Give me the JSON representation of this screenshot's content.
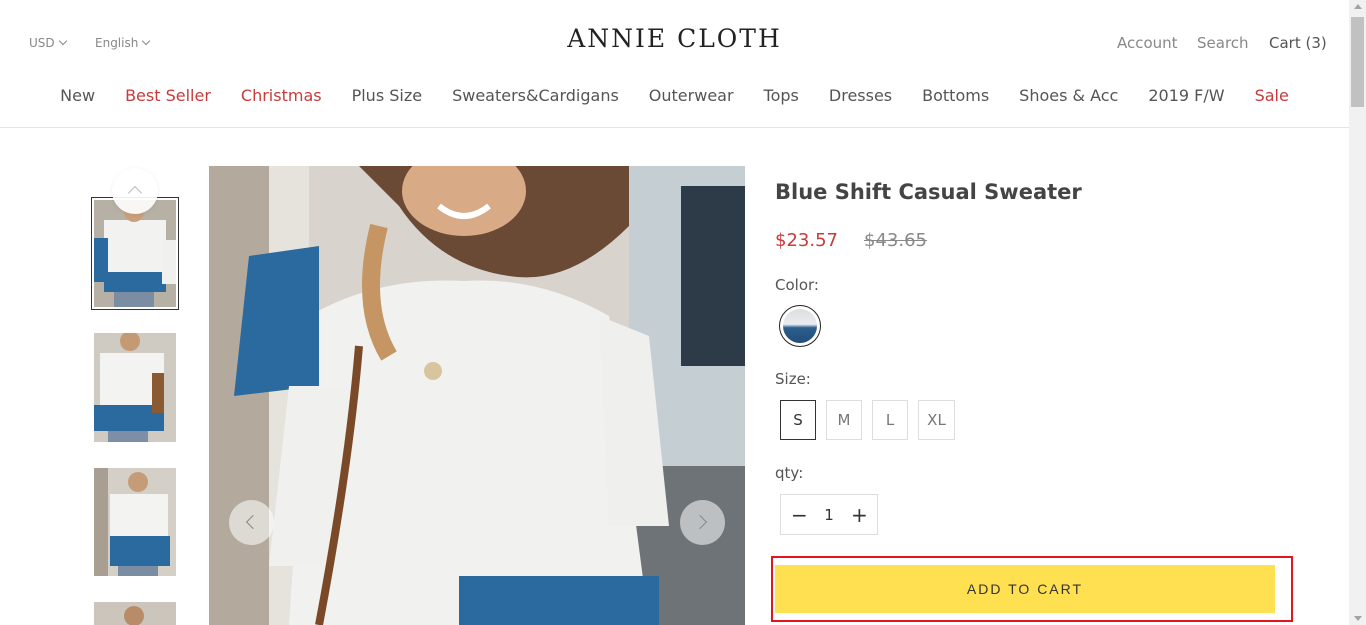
{
  "header": {
    "currency": "USD",
    "language": "English",
    "logo": "ANNIE CLOTH",
    "account": "Account",
    "search": "Search",
    "cart": "Cart (3)"
  },
  "nav": [
    {
      "label": "New",
      "highlight": false
    },
    {
      "label": "Best Seller",
      "highlight": true
    },
    {
      "label": "Christmas",
      "highlight": true
    },
    {
      "label": "Plus Size",
      "highlight": false
    },
    {
      "label": "Sweaters&Cardigans",
      "highlight": false
    },
    {
      "label": "Outerwear",
      "highlight": false
    },
    {
      "label": "Tops",
      "highlight": false
    },
    {
      "label": "Dresses",
      "highlight": false
    },
    {
      "label": "Bottoms",
      "highlight": false
    },
    {
      "label": "Shoes & Acc",
      "highlight": false
    },
    {
      "label": "2019 F/W",
      "highlight": false
    },
    {
      "label": "Sale",
      "highlight": true
    }
  ],
  "product": {
    "title": "Blue Shift Casual Sweater",
    "price": "$23.57",
    "old_price": "$43.65",
    "color_label": "Color:",
    "size_label": "Size:",
    "sizes": [
      "S",
      "M",
      "L",
      "XL"
    ],
    "selected_size": "S",
    "qty_label": "qty:",
    "qty": "1",
    "add_to_cart": "ADD TO CART"
  },
  "colors": {
    "accent_red": "#c73b3b",
    "cart_button": "#ffe051",
    "highlight_box": "#e0181e",
    "sweater_blue": "#2b6a9e"
  }
}
